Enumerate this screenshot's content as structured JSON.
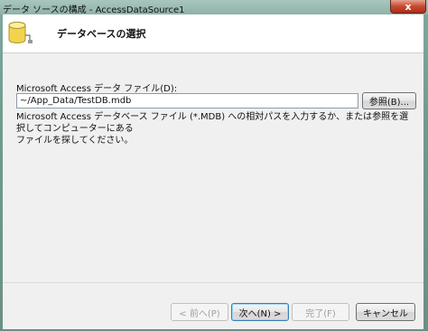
{
  "window": {
    "title": "データ ソースの構成 - AccessDataSource1",
    "close_glyph": "x"
  },
  "header": {
    "icon": "database-icon",
    "title": "データベースの選択"
  },
  "form": {
    "path_label": "Microsoft Access データ ファイル(D):",
    "path_value": "~/App_Data/TestDB.mdb",
    "browse_label": "参照(B)...",
    "description_line1": "Microsoft Access データベース ファイル (*.MDB) への相対パスを入力するか、または参照を選択してコンピューターにある",
    "description_line2": "ファイルを探してください。"
  },
  "footer": {
    "prev_label": "< 前へ(P)",
    "next_label": "次へ(N) >",
    "finish_label": "完了(F)",
    "cancel_label": "キャンセル"
  },
  "colors": {
    "client_bg": "#f0f0f0",
    "close_button": "#c84a33"
  }
}
